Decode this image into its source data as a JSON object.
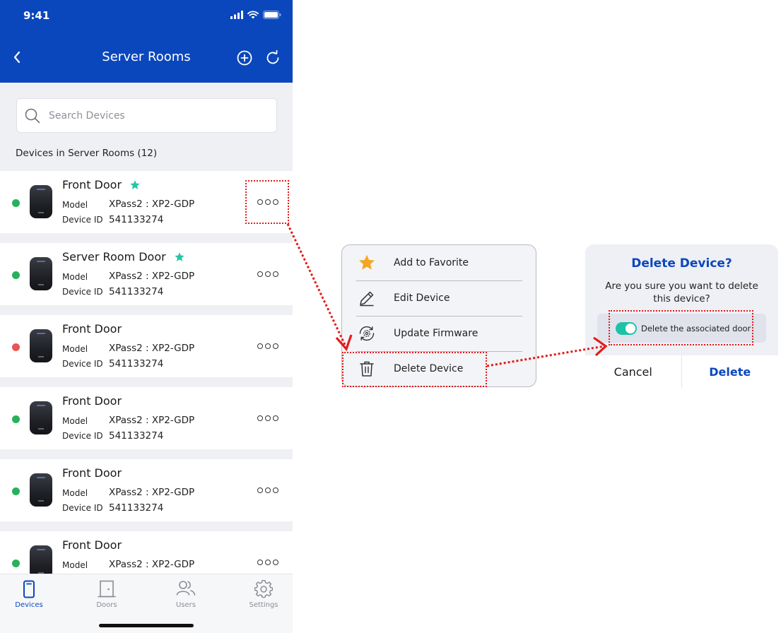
{
  "status_bar": {
    "time": "9:41"
  },
  "header": {
    "title": "Server Rooms"
  },
  "search": {
    "placeholder": "Search Devices"
  },
  "list": {
    "section_label": "Devices in Server Rooms (12)",
    "model_label": "Model",
    "device_id_label": "Device ID",
    "devices": [
      {
        "name": "Front Door",
        "favorite": true,
        "status": "online",
        "model": "XPass2 : XP2-GDP",
        "device_id": "541133274"
      },
      {
        "name": "Server Room Door",
        "favorite": true,
        "status": "online",
        "model": "XPass2 : XP2-GDP",
        "device_id": "541133274"
      },
      {
        "name": "Front Door",
        "favorite": false,
        "status": "offline",
        "model": "XPass2 : XP2-GDP",
        "device_id": "541133274"
      },
      {
        "name": "Front Door",
        "favorite": false,
        "status": "online",
        "model": "XPass2 : XP2-GDP",
        "device_id": "541133274"
      },
      {
        "name": "Front Door",
        "favorite": false,
        "status": "online",
        "model": "XPass2 : XP2-GDP",
        "device_id": "541133274"
      },
      {
        "name": "Front Door",
        "favorite": false,
        "status": "online",
        "model": "XPass2 : XP2-GDP",
        "device_id": ""
      }
    ]
  },
  "tabs": [
    {
      "label": "Devices",
      "icon": "device-icon",
      "active": true
    },
    {
      "label": "Doors",
      "icon": "door-icon",
      "active": false
    },
    {
      "label": "Users",
      "icon": "users-icon",
      "active": false
    },
    {
      "label": "Settings",
      "icon": "gear-icon",
      "active": false
    }
  ],
  "context_menu": {
    "items": [
      {
        "label": "Add to Favorite",
        "icon": "star-icon"
      },
      {
        "label": "Edit Device",
        "icon": "pencil-icon"
      },
      {
        "label": "Update Firmware",
        "icon": "firmware-update-icon"
      },
      {
        "label": "Delete Device",
        "icon": "trash-icon"
      }
    ]
  },
  "dialog": {
    "title": "Delete Device?",
    "message": "Are you sure you want to delete this device?",
    "option_label": "Delete the associated door",
    "option_enabled": true,
    "cancel_label": "Cancel",
    "delete_label": "Delete"
  },
  "colors": {
    "brand": "#0b47bc",
    "online": "#27b15a",
    "offline": "#ea5455",
    "favorite": "#23c6a4",
    "toggle_on": "#1ec3a6",
    "annotation": "#e41a1a",
    "menu_star": "#f4a623"
  }
}
